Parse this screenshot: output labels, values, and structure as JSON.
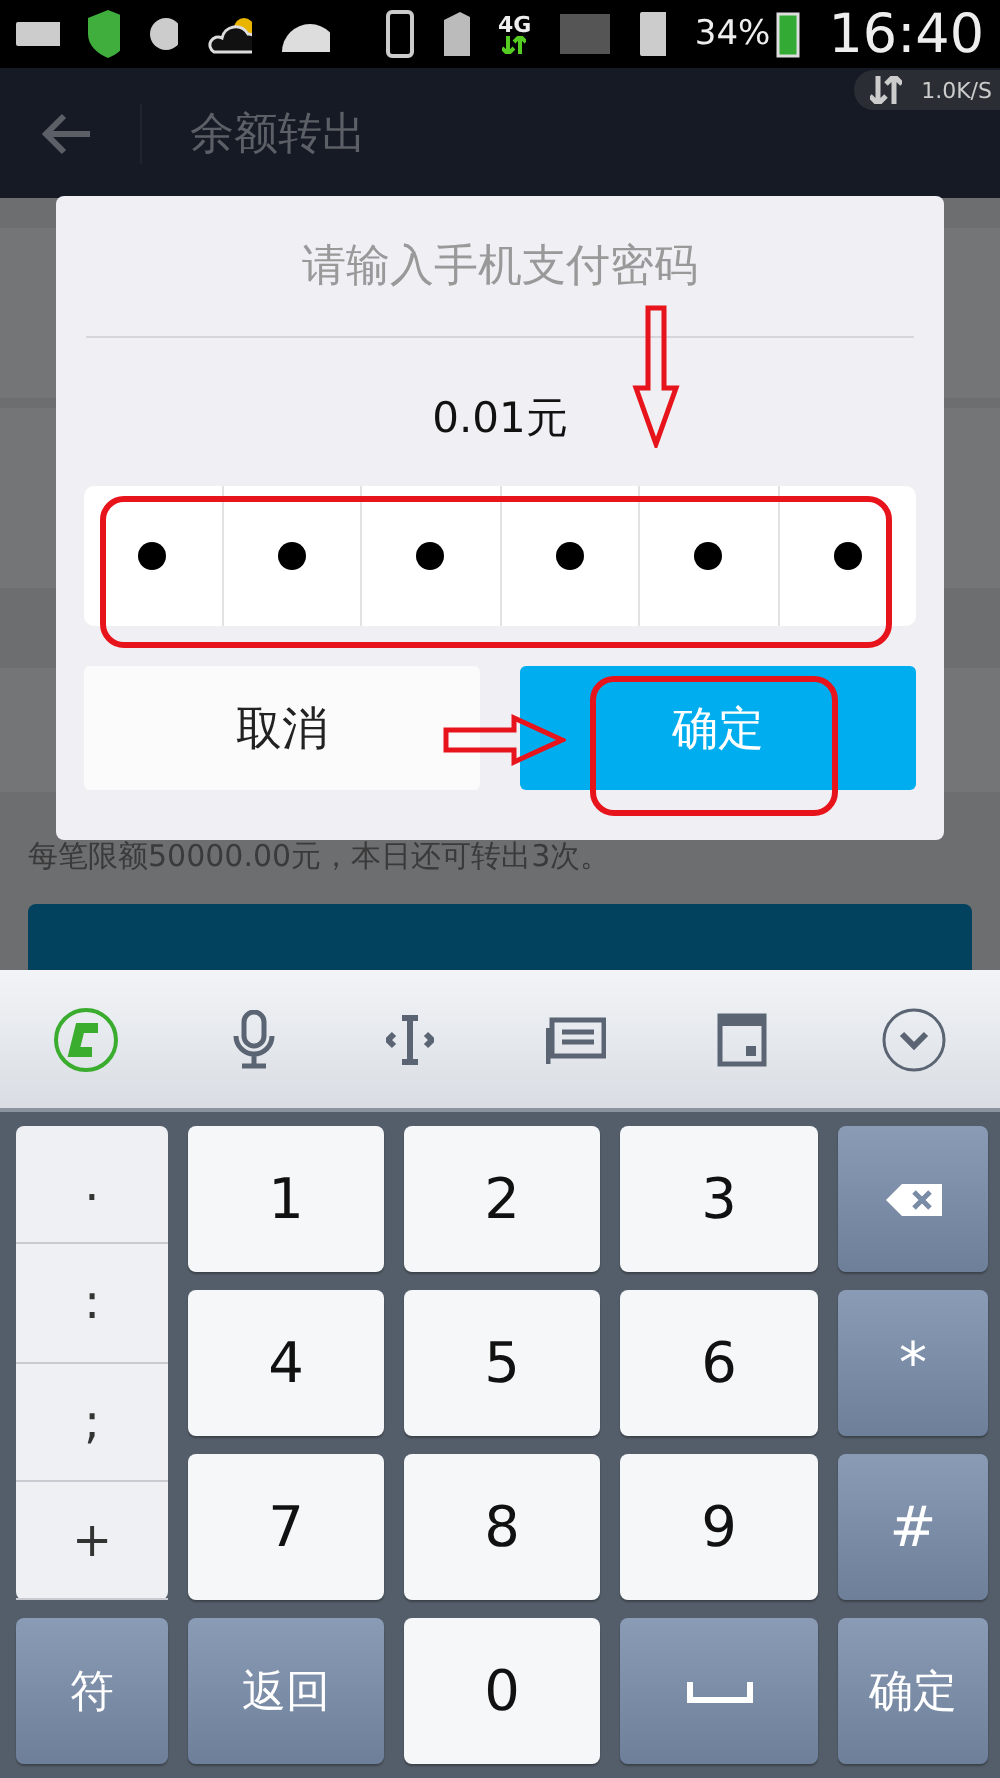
{
  "status_bar": {
    "network": "4G",
    "battery": "34%",
    "time": "16:40",
    "speed": "1.0K/S"
  },
  "header": {
    "title": "余额转出"
  },
  "background": {
    "note": "每笔限额50000.00元，本日还可转出3次。"
  },
  "dialog": {
    "title": "请输入手机支付密码",
    "amount": "0.01元",
    "pin_boxes": [
      {
        "filled": true
      },
      {
        "filled": true
      },
      {
        "filled": true
      },
      {
        "filled": true
      },
      {
        "filled": true
      },
      {
        "filled": true
      }
    ],
    "buttons": [
      {
        "label": "取消",
        "kind": "secondary"
      },
      {
        "label": "确定",
        "kind": "primary"
      }
    ]
  },
  "keyboard": {
    "symbols": [
      ".",
      ":",
      ";",
      "+"
    ],
    "rows": [
      [
        {
          "label": "1",
          "kind": "light"
        },
        {
          "label": "2",
          "kind": "light"
        },
        {
          "label": "3",
          "kind": "light"
        },
        {
          "kind": "backspace"
        }
      ],
      [
        {
          "label": "4",
          "kind": "light"
        },
        {
          "label": "5",
          "kind": "light"
        },
        {
          "label": "6",
          "kind": "light"
        },
        {
          "label": "*",
          "kind": "dark"
        }
      ],
      [
        {
          "label": "7",
          "kind": "light"
        },
        {
          "label": "8",
          "kind": "light"
        },
        {
          "label": "9",
          "kind": "light"
        },
        {
          "label": "#",
          "kind": "dark"
        }
      ]
    ],
    "bottom_row": [
      {
        "label": "符",
        "kind": "dark"
      },
      {
        "label": "返回",
        "kind": "dark"
      },
      {
        "label": "0",
        "kind": "light"
      },
      {
        "kind": "space"
      },
      {
        "label": "确定",
        "kind": "dark"
      }
    ]
  }
}
